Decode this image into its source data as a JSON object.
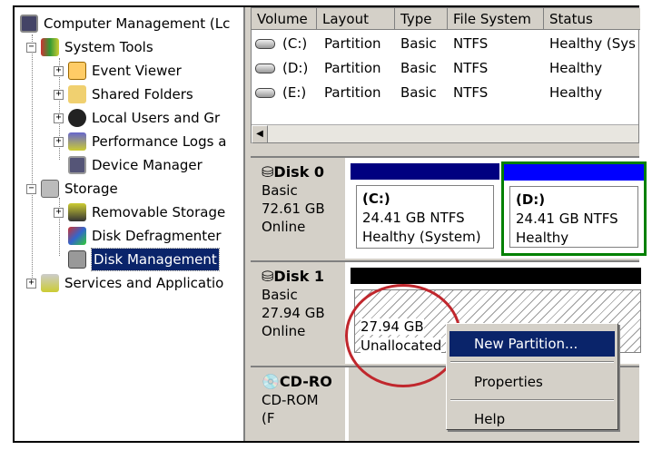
{
  "tree": {
    "items": [
      {
        "label": "Computer Management (Lc",
        "expander": ""
      },
      {
        "label": "System Tools",
        "expander": "−"
      },
      {
        "label": "Event Viewer",
        "expander": "+"
      },
      {
        "label": "Shared Folders",
        "expander": "+"
      },
      {
        "label": "Local Users and Gr",
        "expander": "+"
      },
      {
        "label": "Performance Logs a",
        "expander": "+"
      },
      {
        "label": "Device Manager",
        "expander": ""
      },
      {
        "label": "Storage",
        "expander": "−"
      },
      {
        "label": "Removable Storage",
        "expander": "+"
      },
      {
        "label": "Disk Defragmenter",
        "expander": ""
      },
      {
        "label": "Disk Management",
        "expander": ""
      },
      {
        "label": "Services and Applicatio",
        "expander": "+"
      }
    ]
  },
  "volumes": {
    "headers": [
      "Volume",
      "Layout",
      "Type",
      "File System",
      "Status"
    ],
    "rows": [
      [
        "(C:)",
        "Partition",
        "Basic",
        "NTFS",
        "Healthy (Sys"
      ],
      [
        "(D:)",
        "Partition",
        "Basic",
        "NTFS",
        "Healthy"
      ],
      [
        "(E:)",
        "Partition",
        "Basic",
        "NTFS",
        "Healthy"
      ]
    ]
  },
  "disks": [
    {
      "name": "Disk 0",
      "type": "Basic",
      "size": "72.61 GB",
      "state": "Online",
      "partitions": [
        {
          "letter": "(C:)",
          "size": "24.41 GB NTFS",
          "status": "Healthy (System)"
        },
        {
          "letter": "(D:)",
          "size": "24.41 GB NTFS",
          "status": "Healthy"
        }
      ]
    },
    {
      "name": "Disk 1",
      "type": "Basic",
      "size": "27.94 GB",
      "state": "Online",
      "unallocated": {
        "size": "27.94 GB",
        "label": "Unallocated"
      }
    },
    {
      "name": "CD-RO",
      "type": "CD-ROM (F"
    }
  ],
  "context_menu": {
    "items": [
      "New Partition...",
      "Properties",
      "Help"
    ]
  },
  "colors": {
    "primary_partition": "#000080",
    "selected_partition": "#0000ff",
    "highlight": "#0a246a",
    "annotation": "#c0272d"
  }
}
